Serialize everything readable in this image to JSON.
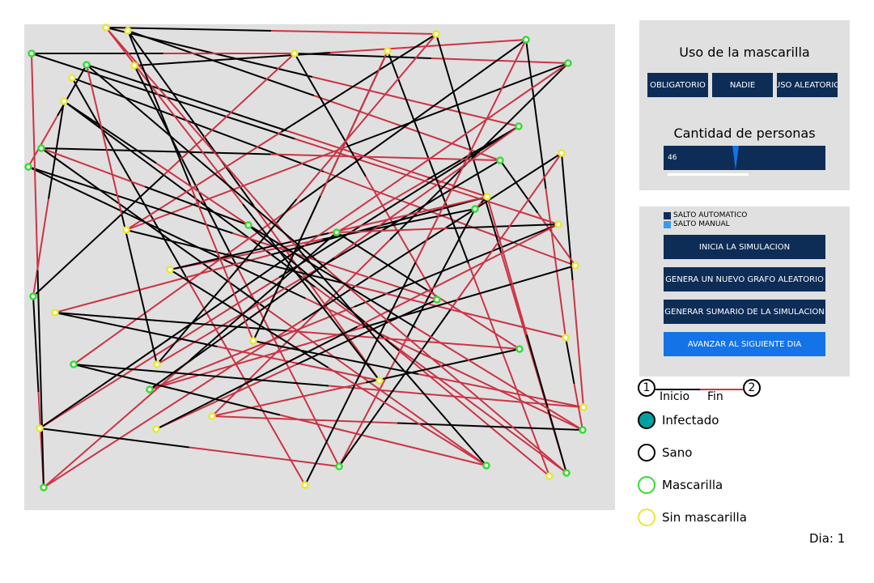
{
  "mask_panel": {
    "title": "Uso de la mascarilla",
    "buttons": [
      "OBLIGATORIO",
      "NADIE",
      "USO ALEATORIO"
    ],
    "people_label": "Cantidad de personas",
    "people_count": "46"
  },
  "sim_panel": {
    "modes": [
      {
        "label": "SALTO AUTOMATICO",
        "color": "#0d2d57"
      },
      {
        "label": "SALTO MANUAL",
        "color": "#3b9bea"
      }
    ],
    "buttons": [
      "INICIA LA SIMULACION",
      "GENERA UN NUEVO GRAFO ALEATORIO",
      "GENERAR SUMARIO DE LA SIMULACION",
      "AVANZAR AL SIGUIENTE DIA"
    ],
    "active_button": 3
  },
  "edge_legend": {
    "start_number": "1",
    "end_number": "2",
    "start_label": "Inicio",
    "end_label": "Fin"
  },
  "legend": [
    {
      "label": "Infectado",
      "type": "infected"
    },
    {
      "label": "Sano",
      "type": "healthy"
    },
    {
      "label": "Mascarilla",
      "type": "mask"
    },
    {
      "label": "Sin mascarilla",
      "type": "nomask"
    }
  ],
  "day": {
    "label": "Dia:",
    "value": "1"
  },
  "colors": {
    "infected": "#00a0a0",
    "healthy": "#000000",
    "mask": "#33dd33",
    "nomask": "#e8e833",
    "edge_start": "#000000",
    "edge_end": "#cc3344"
  }
}
